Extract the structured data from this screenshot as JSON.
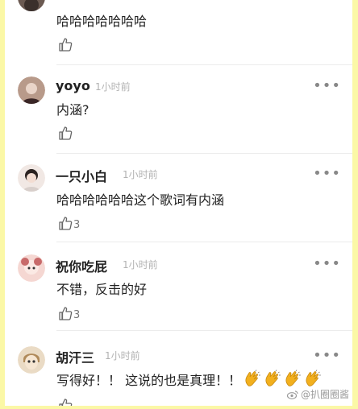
{
  "comments": [
    {
      "username": "",
      "time": "",
      "text": "哈哈哈哈哈哈哈",
      "likes": "",
      "avatar_colors": [
        "#6b5a52",
        "#3b302c"
      ]
    },
    {
      "username": "yoyo",
      "time": "1小时前",
      "text": "内涵?",
      "likes": "",
      "avatar_colors": [
        "#b89a8a",
        "#3a2626"
      ]
    },
    {
      "username": "一只小白",
      "time": "1小时前",
      "text": "哈哈哈哈哈哈这个歌词有内涵",
      "likes": "3",
      "avatar_colors": [
        "#f1e8e4",
        "#2b2220"
      ]
    },
    {
      "username": "祝你吃屁",
      "time": "1小时前",
      "text": "不错，反击的好",
      "likes": "3",
      "avatar_colors": [
        "#f5d7d2",
        "#c86a6a"
      ]
    },
    {
      "username": "胡汗三",
      "time": "1小时前",
      "text": "写得好！！ 这说的也是真理！！",
      "likes": "",
      "avatar_colors": [
        "#eadbc5",
        "#b08a5a"
      ],
      "emoji": [
        "clap",
        "clap",
        "clap",
        "clap"
      ]
    }
  ],
  "more_label": "•••",
  "watermark": "@扒圈圈酱",
  "colors": {
    "background": "#fbf8a6",
    "name": "#222222",
    "time": "#b2b2b2",
    "clap": "#f2b01e"
  }
}
